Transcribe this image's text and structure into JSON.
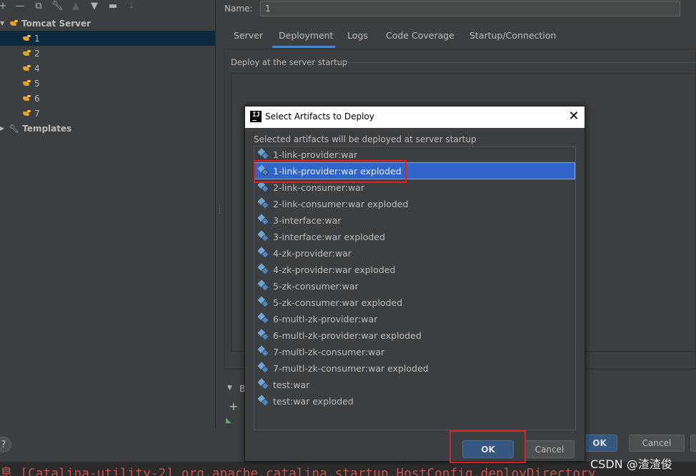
{
  "left_tree": {
    "toolbar_icons": [
      "add-icon",
      "remove-icon",
      "copy-icon",
      "wrench-icon",
      "move-up-icon",
      "move-down-icon",
      "new-folder-icon",
      "sort-icon"
    ],
    "root_label": "Tomcat Server",
    "items": [
      {
        "label": "1",
        "selected": true
      },
      {
        "label": "2",
        "selected": false
      },
      {
        "label": "4",
        "selected": false
      },
      {
        "label": "5",
        "selected": false
      },
      {
        "label": "6",
        "selected": false
      },
      {
        "label": "7",
        "selected": false
      }
    ],
    "templates_label": "Templates"
  },
  "config": {
    "name_label": "Name:",
    "name_value": "1",
    "tabs": [
      {
        "label": "Server",
        "active": false
      },
      {
        "label": "Deployment",
        "active": true
      },
      {
        "label": "Logs",
        "active": false
      },
      {
        "label": "Code Coverage",
        "active": false
      },
      {
        "label": "Startup/Connection",
        "active": false
      }
    ],
    "deploy_section_label": "Deploy at the server startup",
    "before_launch_label": "B",
    "plus_label": "+",
    "help_label": "?",
    "ok_label": "OK",
    "cancel_label": "Cancel"
  },
  "dialog": {
    "title": "Select Artifacts to Deploy",
    "close_label": "✕",
    "description": "Selected artifacts will be deployed at server startup",
    "artifacts": [
      "1-link-provider:war",
      "1-link-provider:war exploded",
      "2-link-consumer:war",
      "2-link-consumer:war exploded",
      "3-interface:war",
      "3-interface:war exploded",
      "4-zk-provider:war",
      "4-zk-provider:war exploded",
      "5-zk-consumer:war",
      "5-zk-consumer:war exploded",
      "6-multl-zk-provider:war",
      "6-multl-zk-provider:war exploded",
      "7-multl-zk-consumer:war",
      "7-multl-zk-consumer:war exploded",
      "test:war",
      "test:war exploded"
    ],
    "selected_artifact": "1-link-provider:war exploded",
    "ok_label": "OK",
    "cancel_label": "Cancel"
  },
  "console": {
    "text": "息 [Catalina-utility-2] org.apache.catalina.startup.HostConfig.deployDirectory"
  },
  "watermark": "CSDN @渣渣俊",
  "colors": {
    "background": "#3c3f41",
    "selection": "#2f65ca",
    "tree_selection": "#0d293e",
    "primary_button": "#365880",
    "annotation_red": "#e02020",
    "console_error": "#c75450"
  }
}
